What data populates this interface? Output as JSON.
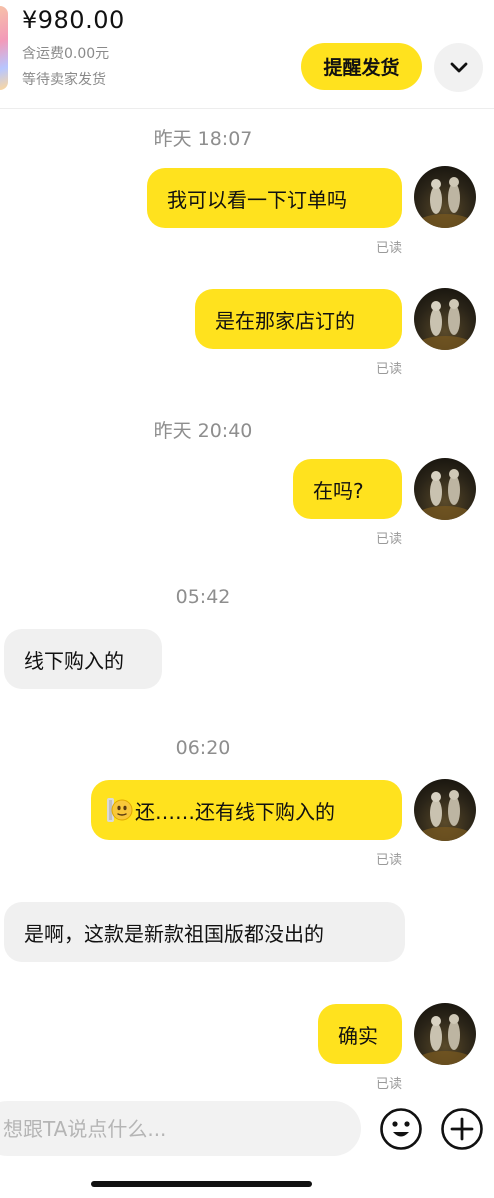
{
  "order": {
    "price": "¥980.00",
    "shipping": "含运费0.00元",
    "status": "等待卖家发货",
    "remind_label": "提醒发货",
    "expand_icon": "chevron-down-icon"
  },
  "read_label": "已读",
  "chat": {
    "timestamps": [
      "昨天 18:07",
      "昨天 20:40",
      "05:42",
      "06:20"
    ],
    "messages": [
      {
        "direction": "out",
        "text": "我可以看一下订单吗",
        "read": true
      },
      {
        "direction": "out",
        "text": "是在那家店订的",
        "read": true
      },
      {
        "direction": "out",
        "text": "在吗?",
        "read": true
      },
      {
        "direction": "in",
        "text": "线下购入的"
      },
      {
        "direction": "out",
        "emoji": "peeking-face-emoji",
        "text": "还……还有线下购入的",
        "read": true
      },
      {
        "direction": "in",
        "text": "是啊，这款是新款祖国版都没出的"
      },
      {
        "direction": "out",
        "text": "确实",
        "read": true
      }
    ]
  },
  "input": {
    "placeholder": "想跟TA说点什么...",
    "emoji_icon": "smiley-face-icon",
    "plus_icon": "plus-circle-icon"
  },
  "colors": {
    "accent": "#ffe21e",
    "incoming_bubble": "#f0f0f0",
    "muted_text": "#8e8e8e"
  }
}
